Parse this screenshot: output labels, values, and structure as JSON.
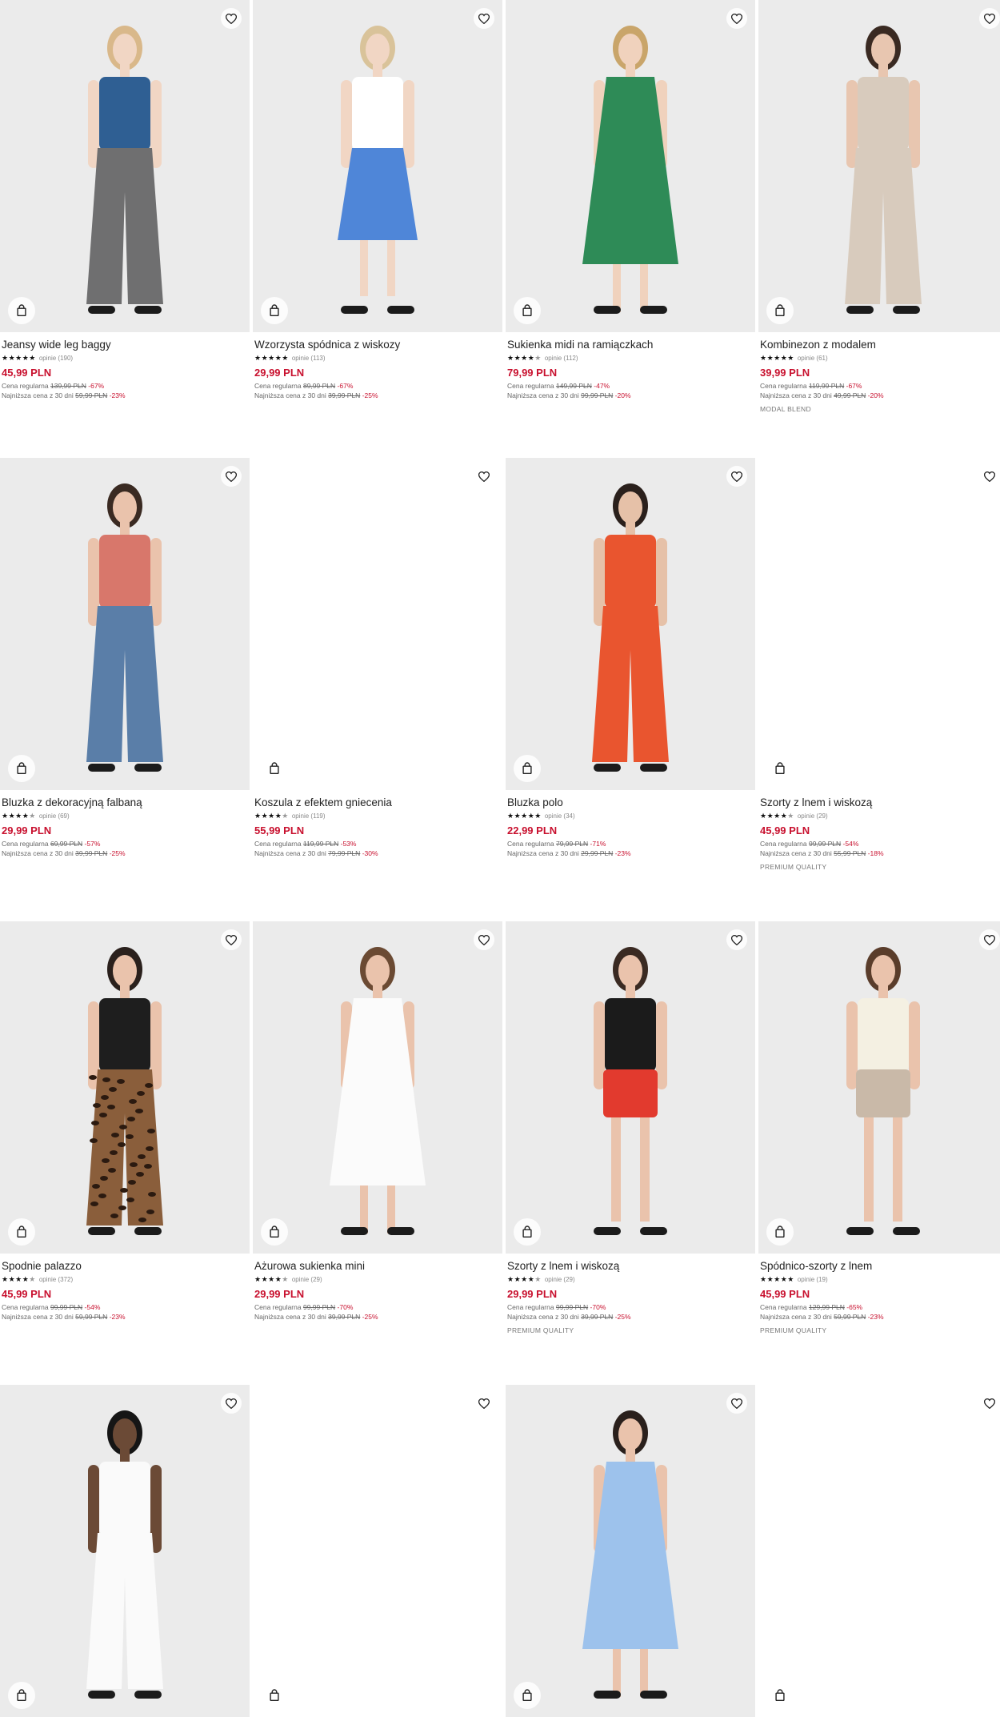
{
  "currency_note": "PLN",
  "colors": {
    "price": "#c8102e",
    "image_bg": "#ebebeb"
  },
  "products": [
    {
      "name": "Jeansy wide leg baggy",
      "reviews": "opinie (190)",
      "price": "45,99 PLN",
      "regular_label": "Cena regularna",
      "regular_price": "139,99 PLN",
      "regular_discount": "-67%",
      "lowest_label": "Najniższa cena z 30 dni",
      "lowest_price": "59,99 PLN",
      "lowest_discount": "-23%",
      "tag": "",
      "rating": 5
    },
    {
      "name": "Wzorzysta spódnica z wiskozy",
      "reviews": "opinie (113)",
      "price": "29,99 PLN",
      "regular_label": "Cena regularna",
      "regular_price": "89,99 PLN",
      "regular_discount": "-67%",
      "lowest_label": "Najniższa cena z 30 dni",
      "lowest_price": "39,99 PLN",
      "lowest_discount": "-25%",
      "tag": "",
      "rating": 5
    },
    {
      "name": "Sukienka midi na ramiączkach",
      "reviews": "opinie (112)",
      "price": "79,99 PLN",
      "regular_label": "Cena regularna",
      "regular_price": "149,99 PLN",
      "regular_discount": "-47%",
      "lowest_label": "Najniższa cena z 30 dni",
      "lowest_price": "99,99 PLN",
      "lowest_discount": "-20%",
      "tag": "",
      "rating": 4.5
    },
    {
      "name": "Kombinezon z modalem",
      "reviews": "opinie (61)",
      "price": "39,99 PLN",
      "regular_label": "Cena regularna",
      "regular_price": "119,99 PLN",
      "regular_discount": "-67%",
      "lowest_label": "Najniższa cena z 30 dni",
      "lowest_price": "49,99 PLN",
      "lowest_discount": "-20%",
      "tag": "MODAL BLEND",
      "rating": 5
    },
    {
      "name": "Bluzka z dekoracyjną falbaną",
      "reviews": "opinie (69)",
      "price": "29,99 PLN",
      "regular_label": "Cena regularna",
      "regular_price": "69,99 PLN",
      "regular_discount": "-57%",
      "lowest_label": "Najniższa cena z 30 dni",
      "lowest_price": "39,99 PLN",
      "lowest_discount": "-25%",
      "tag": "",
      "rating": 4.5
    },
    {
      "name": "Koszula z efektem gniecenia",
      "reviews": "opinie (119)",
      "price": "55,99 PLN",
      "regular_label": "Cena regularna",
      "regular_price": "119,99 PLN",
      "regular_discount": "-53%",
      "lowest_label": "Najniższa cena z 30 dni",
      "lowest_price": "79,99 PLN",
      "lowest_discount": "-30%",
      "tag": "",
      "rating": 4.5
    },
    {
      "name": "Bluzka polo",
      "reviews": "opinie (34)",
      "price": "22,99 PLN",
      "regular_label": "Cena regularna",
      "regular_price": "79,99 PLN",
      "regular_discount": "-71%",
      "lowest_label": "Najniższa cena z 30 dni",
      "lowest_price": "29,99 PLN",
      "lowest_discount": "-23%",
      "tag": "",
      "rating": 5
    },
    {
      "name": "Szorty z lnem i wiskozą",
      "reviews": "opinie (29)",
      "price": "45,99 PLN",
      "regular_label": "Cena regularna",
      "regular_price": "99,99 PLN",
      "regular_discount": "-54%",
      "lowest_label": "Najniższa cena z 30 dni",
      "lowest_price": "55,99 PLN",
      "lowest_discount": "-18%",
      "tag": "PREMIUM QUALITY",
      "rating": 4.5
    },
    {
      "name": "Spodnie palazzo",
      "reviews": "opinie (372)",
      "price": "45,99 PLN",
      "regular_label": "Cena regularna",
      "regular_price": "99,99 PLN",
      "regular_discount": "-54%",
      "lowest_label": "Najniższa cena z 30 dni",
      "lowest_price": "59,99 PLN",
      "lowest_discount": "-23%",
      "tag": "",
      "rating": 4.5
    },
    {
      "name": "Ażurowa sukienka mini",
      "reviews": "opinie (29)",
      "price": "29,99 PLN",
      "regular_label": "Cena regularna",
      "regular_price": "99,99 PLN",
      "regular_discount": "-70%",
      "lowest_label": "Najniższa cena z 30 dni",
      "lowest_price": "39,99 PLN",
      "lowest_discount": "-25%",
      "tag": "",
      "rating": 4.5
    },
    {
      "name": "Szorty z lnem i wiskozą",
      "reviews": "opinie (29)",
      "price": "29,99 PLN",
      "regular_label": "Cena regularna",
      "regular_price": "99,99 PLN",
      "regular_discount": "-70%",
      "lowest_label": "Najniższa cena z 30 dni",
      "lowest_price": "39,99 PLN",
      "lowest_discount": "-25%",
      "tag": "PREMIUM QUALITY",
      "rating": 4.5
    },
    {
      "name": "Spódnico-szorty z lnem",
      "reviews": "opinie (19)",
      "price": "45,99 PLN",
      "regular_label": "Cena regularna",
      "regular_price": "129,99 PLN",
      "regular_discount": "-65%",
      "lowest_label": "Najniższa cena z 30 dni",
      "lowest_price": "59,99 PLN",
      "lowest_discount": "-23%",
      "tag": "PREMIUM QUALITY",
      "rating": 5
    }
  ],
  "icons": {
    "favorite": "heart-icon",
    "add_to_cart": "bag-icon"
  }
}
